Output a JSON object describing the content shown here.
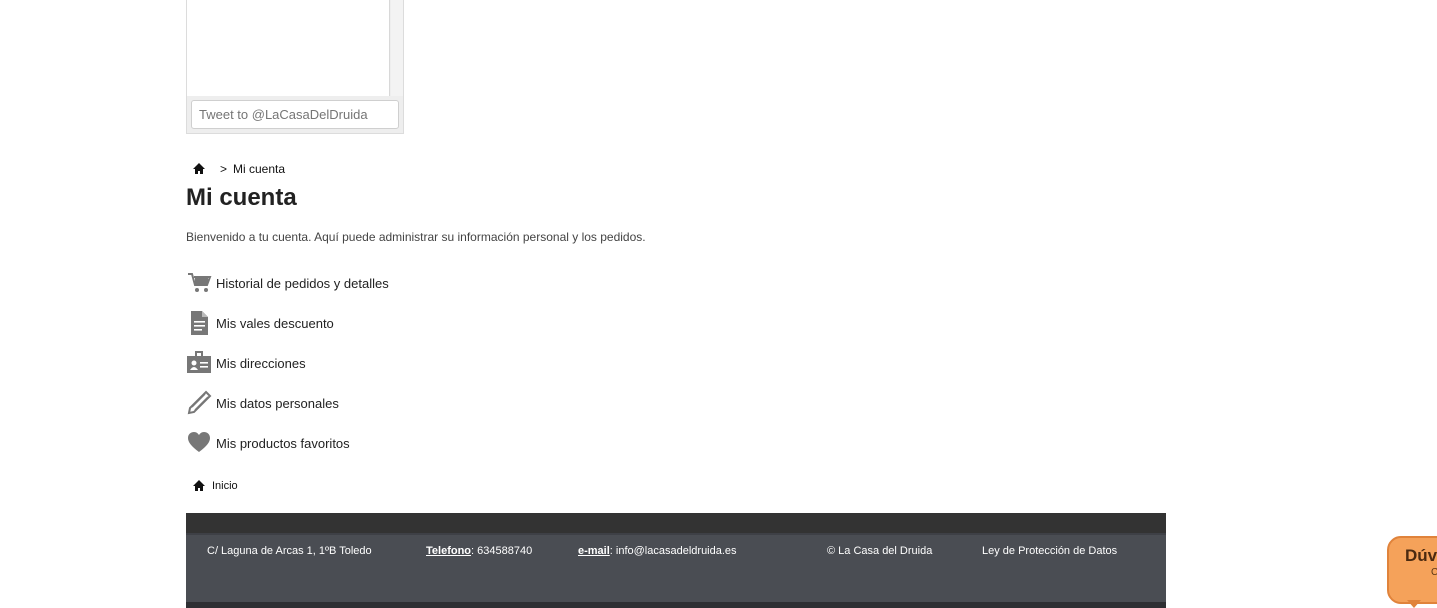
{
  "twitter": {
    "tweet_placeholder": "Tweet to @LaCasaDelDruida"
  },
  "breadcrumb": {
    "separator": ">",
    "current": "Mi cuenta"
  },
  "page": {
    "title": "Mi cuenta",
    "welcome": "Bienvenido a tu cuenta. Aquí puede administrar su información personal y los pedidos."
  },
  "account_links": [
    {
      "label": "Historial de pedidos y detalles",
      "icon": "cart-icon"
    },
    {
      "label": "Mis vales descuento",
      "icon": "document-icon"
    },
    {
      "label": "Mis direcciones",
      "icon": "address-card-icon"
    },
    {
      "label": "Mis datos personales",
      "icon": "pencil-icon"
    },
    {
      "label": "Mis productos favoritos",
      "icon": "heart-icon"
    }
  ],
  "footer_home": {
    "label": "Inicio"
  },
  "footer": {
    "address": "C/ Laguna de Arcas 1, 1ºB   Toledo",
    "phone_label": "Telefono",
    "phone_value": ": 634588740",
    "email_label": " e-mail",
    "email_value": ": info@lacasadeldruida.es",
    "copyright": "© La Casa del Druida",
    "privacy": "Ley de Protección de Datos"
  },
  "help_bubble": {
    "title": "Dúv",
    "subtitle": "C"
  },
  "colors": {
    "footer_bg": "#4a4d53",
    "accent_bubble": "#f5a25a",
    "icon_gray": "#777777"
  }
}
